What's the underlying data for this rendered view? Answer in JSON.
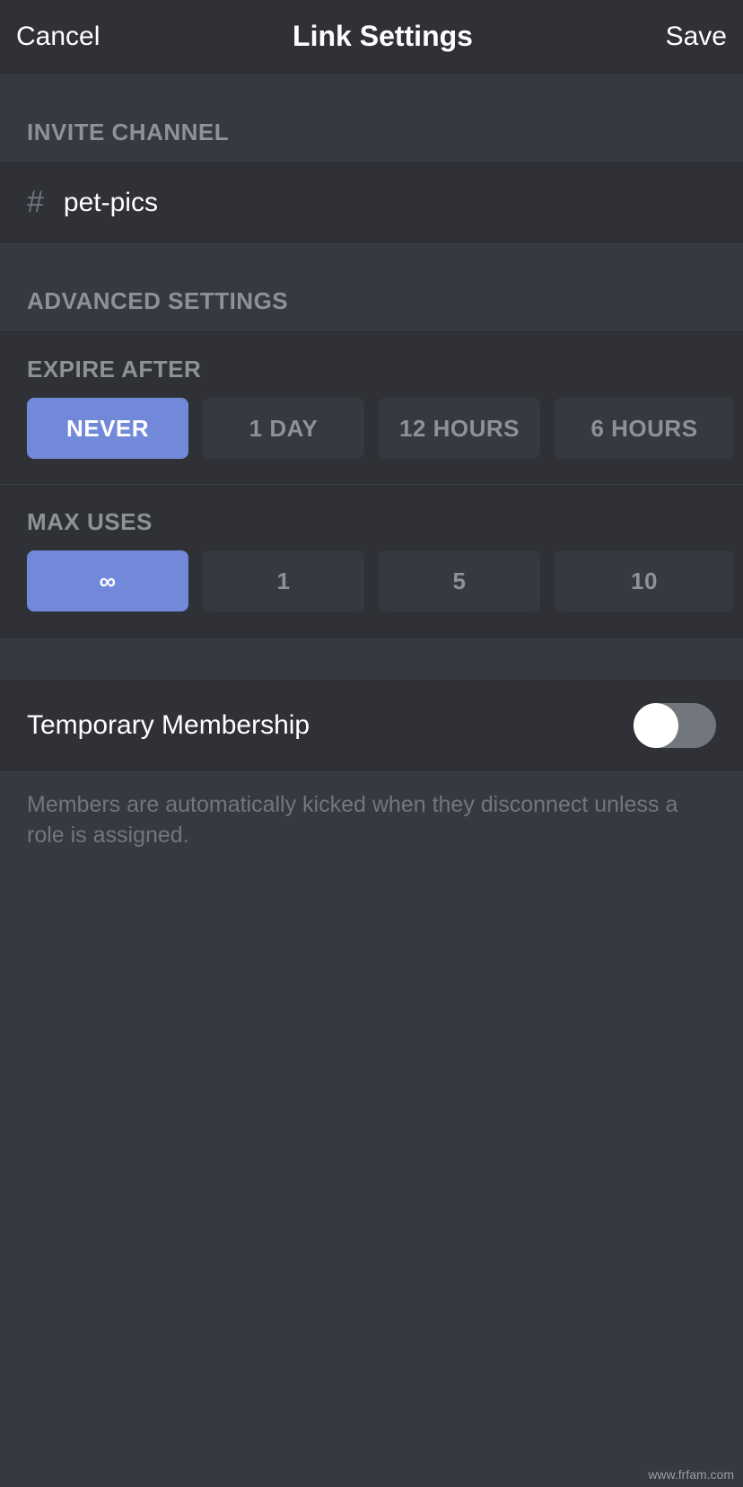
{
  "header": {
    "cancel": "Cancel",
    "title": "Link Settings",
    "save": "Save"
  },
  "invite_channel": {
    "header": "INVITE CHANNEL",
    "icon": "#",
    "name": "pet-pics"
  },
  "advanced": {
    "header": "ADVANCED SETTINGS",
    "expire_label": "EXPIRE AFTER",
    "expire_options": [
      "NEVER",
      "1 DAY",
      "12 HOURS",
      "6 HOURS"
    ],
    "expire_selected_index": 0,
    "max_uses_label": "MAX USES",
    "max_uses_options": [
      "∞",
      "1",
      "5",
      "10"
    ],
    "max_uses_selected_index": 0
  },
  "temporary_membership": {
    "label": "Temporary Membership",
    "enabled": false,
    "help": "Members are automatically kicked when they disconnect unless a role is assigned."
  },
  "watermark": "www.frfam.com"
}
